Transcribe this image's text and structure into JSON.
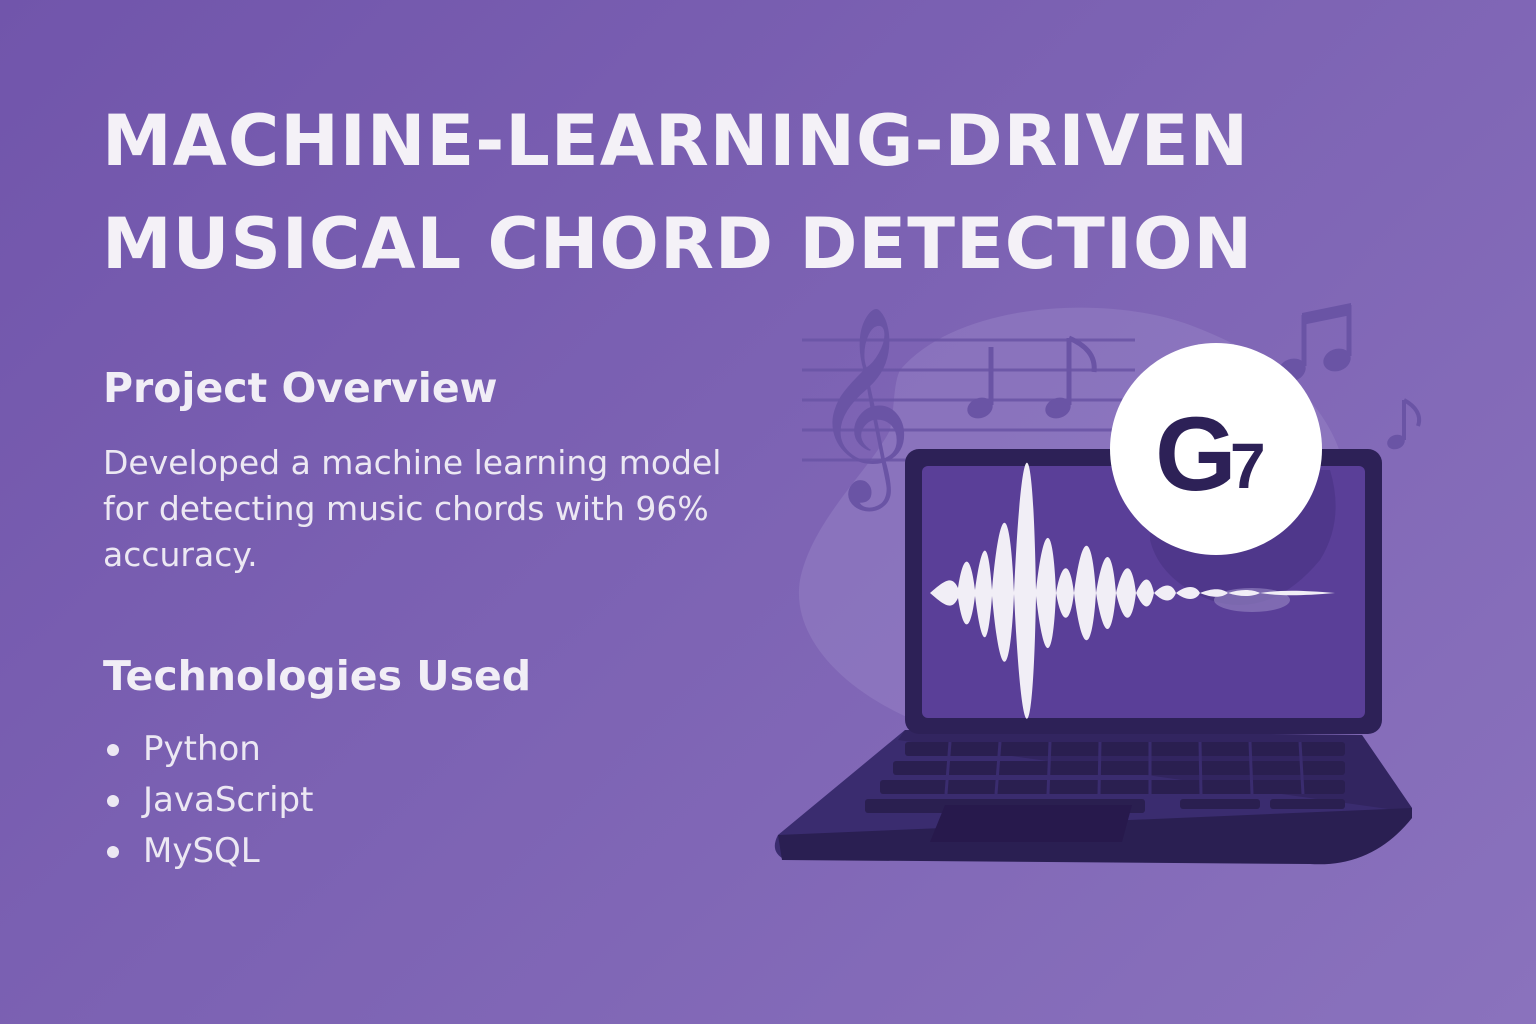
{
  "title": {
    "line1": "MACHINE-LEARNING-DRIVEN",
    "line2": "MUSICAL CHORD DETECTION"
  },
  "overview": {
    "heading": "Project Overview",
    "text": "Developed a machine learning model for detecting music chords with 96% accuracy."
  },
  "technologies": {
    "heading": "Technologies Used",
    "items": [
      "Python",
      "JavaScript",
      "MySQL"
    ]
  },
  "illustration": {
    "chord_root": "G",
    "chord_extension": "7",
    "icons": [
      "treble-clef-icon",
      "music-note-icon",
      "laptop-icon",
      "waveform-icon"
    ]
  },
  "colors": {
    "background": "#7659ae",
    "text": "#f1eef6",
    "laptop_dark": "#2d2157",
    "screen": "#5a3f98",
    "accent": "#6a4fa8"
  }
}
